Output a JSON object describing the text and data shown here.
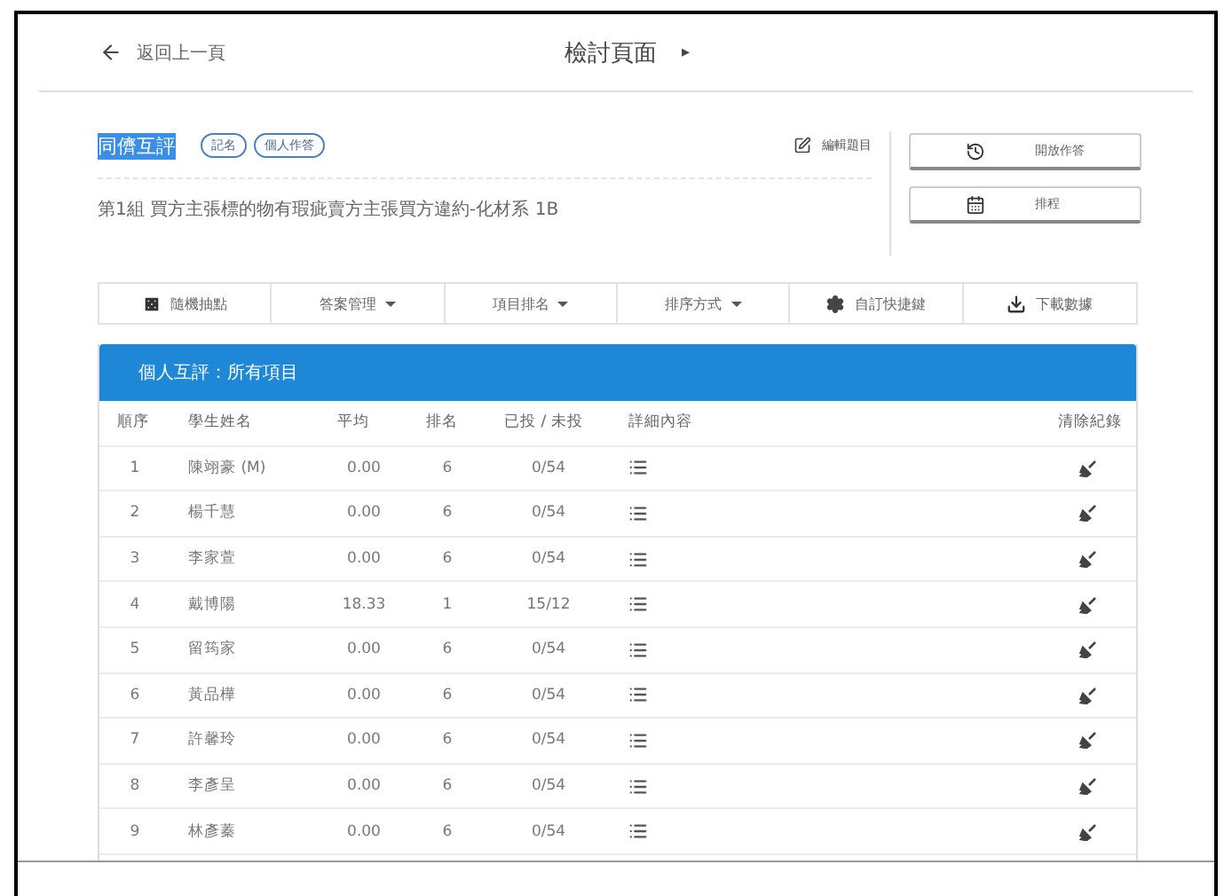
{
  "header": {
    "back": "返回上一頁",
    "title": "檢討頁面",
    "title_arrow": "▸"
  },
  "activity": {
    "title": "同儕互評",
    "highlighted": true,
    "tags": [
      "記名",
      "個人作答"
    ],
    "edit": "編輯題目",
    "description": "第1組 買方主張標的物有瑕疵賣方主張買方違約-化材系 1B"
  },
  "actions": [
    {
      "kind": "open",
      "label": "開放作答"
    },
    {
      "kind": "schedule",
      "label": "排程"
    }
  ],
  "toolbar": [
    {
      "kind": "dice",
      "label": "隨機抽點",
      "dropdown": false
    },
    {
      "kind": "none",
      "label": "答案管理",
      "dropdown": true
    },
    {
      "kind": "none",
      "label": "項目排名",
      "dropdown": true
    },
    {
      "kind": "none",
      "label": "排序方式",
      "dropdown": true
    },
    {
      "kind": "gear",
      "label": "自訂快捷鍵",
      "dropdown": false
    },
    {
      "kind": "download",
      "label": "下載數據",
      "dropdown": false
    }
  ],
  "table": {
    "title": "個人互評：所有項目",
    "columns": [
      "順序",
      "學生姓名",
      "平均",
      "排名",
      "已投 / 未投",
      "詳細內容",
      "清除紀錄"
    ],
    "rows": [
      {
        "no": "1",
        "name": "陳翊豪 (M)",
        "avg": "0.00",
        "rank": "6",
        "votes": "0/54"
      },
      {
        "no": "2",
        "name": "楊千慧",
        "avg": "0.00",
        "rank": "6",
        "votes": "0/54"
      },
      {
        "no": "3",
        "name": "李家萱",
        "avg": "0.00",
        "rank": "6",
        "votes": "0/54"
      },
      {
        "no": "4",
        "name": "戴博陽",
        "avg": "18.33",
        "rank": "1",
        "votes": "15/12"
      },
      {
        "no": "5",
        "name": "留筠家",
        "avg": "0.00",
        "rank": "6",
        "votes": "0/54"
      },
      {
        "no": "6",
        "name": "黃品樺",
        "avg": "0.00",
        "rank": "6",
        "votes": "0/54"
      },
      {
        "no": "7",
        "name": "許馨玲",
        "avg": "0.00",
        "rank": "6",
        "votes": "0/54"
      },
      {
        "no": "8",
        "name": "李彥呈",
        "avg": "0.00",
        "rank": "6",
        "votes": "0/54"
      },
      {
        "no": "9",
        "name": "林彥蓁",
        "avg": "0.00",
        "rank": "6",
        "votes": "0/54"
      }
    ]
  }
}
